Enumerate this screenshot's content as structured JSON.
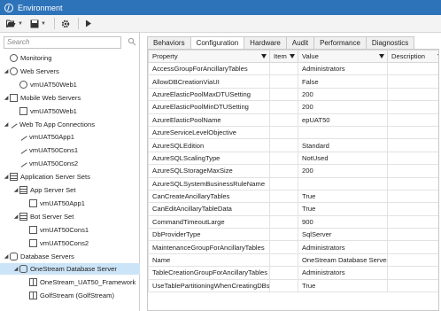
{
  "window": {
    "title": "Environment"
  },
  "toolbar": {
    "open_icon": "folder-open-icon",
    "save_icon": "save-icon",
    "settings_icon": "gear-icon",
    "run_icon": "play-icon"
  },
  "search": {
    "placeholder": "Search"
  },
  "tree": [
    {
      "label": "Monitoring",
      "icon": "monitor",
      "indent": 0,
      "twisty": ""
    },
    {
      "label": "Web Servers",
      "icon": "globe",
      "indent": 0,
      "twisty": "◢"
    },
    {
      "label": "vmUAT50Web1",
      "icon": "globe",
      "indent": 1,
      "twisty": ""
    },
    {
      "label": "Mobile Web Servers",
      "icon": "box",
      "indent": 0,
      "twisty": "◢"
    },
    {
      "label": "vmUAT50Web1",
      "icon": "box",
      "indent": 1,
      "twisty": ""
    },
    {
      "label": "Web To App Connections",
      "icon": "link",
      "indent": 0,
      "twisty": "◢"
    },
    {
      "label": "vmUAT50App1",
      "icon": "link",
      "indent": 1,
      "twisty": ""
    },
    {
      "label": "vmUAT50Cons1",
      "icon": "link",
      "indent": 1,
      "twisty": ""
    },
    {
      "label": "vmUAT50Cons2",
      "icon": "link",
      "indent": 1,
      "twisty": ""
    },
    {
      "label": "Application Server Sets",
      "icon": "server",
      "indent": 0,
      "twisty": "◢"
    },
    {
      "label": "App Server Set",
      "icon": "server",
      "indent": 1,
      "twisty": "◢"
    },
    {
      "label": "vmUAT50App1",
      "icon": "box",
      "indent": 2,
      "twisty": ""
    },
    {
      "label": "Bot Server Set",
      "icon": "server",
      "indent": 1,
      "twisty": "◢"
    },
    {
      "label": "vmUAT50Cons1",
      "icon": "box",
      "indent": 2,
      "twisty": ""
    },
    {
      "label": "vmUAT50Cons2",
      "icon": "box",
      "indent": 2,
      "twisty": ""
    },
    {
      "label": "Database Servers",
      "icon": "db",
      "indent": 0,
      "twisty": "◢"
    },
    {
      "label": "OneStream Database Server",
      "icon": "db",
      "indent": 1,
      "twisty": "◢",
      "selected": true
    },
    {
      "label": "OneStream_UAT50_Framework",
      "icon": "table",
      "indent": 2,
      "twisty": ""
    },
    {
      "label": "GolfStream (GolfStream)",
      "icon": "table",
      "indent": 2,
      "twisty": ""
    }
  ],
  "tabs": [
    "Behaviors",
    "Configuration",
    "Hardware",
    "Audit",
    "Performance",
    "Diagnostics"
  ],
  "grid": {
    "columns": [
      "Property",
      "Item",
      "Value",
      "Description"
    ],
    "rows": [
      [
        "AccessGroupForAncillaryTables",
        "",
        "Administrators",
        ""
      ],
      [
        "AllowDBCreationViaUI",
        "",
        "False",
        ""
      ],
      [
        "AzureElasticPoolMaxDTUSetting",
        "",
        "200",
        ""
      ],
      [
        "AzureElasticPoolMinDTUSetting",
        "",
        "200",
        ""
      ],
      [
        "AzureElasticPoolName",
        "",
        "epUAT50",
        ""
      ],
      [
        "AzureServiceLevelObjective",
        "",
        "",
        ""
      ],
      [
        "AzureSQLEdition",
        "",
        "Standard",
        ""
      ],
      [
        "AzureSQLScalingType",
        "",
        "NotUsed",
        ""
      ],
      [
        "AzureSQLStorageMaxSize",
        "",
        "200",
        ""
      ],
      [
        "AzureSQLSystemBusinessRuleName",
        "",
        "",
        ""
      ],
      [
        "CanCreateAncillaryTables",
        "",
        "True",
        ""
      ],
      [
        "CanEditAncillaryTableData",
        "",
        "True",
        ""
      ],
      [
        "CommandTimeoutLarge",
        "",
        "900",
        ""
      ],
      [
        "DbProviderType",
        "",
        "SqlServer",
        ""
      ],
      [
        "MaintenanceGroupForAncillaryTables",
        "",
        "Administrators",
        ""
      ],
      [
        "Name",
        "",
        "OneStream Database Server",
        ""
      ],
      [
        "TableCreationGroupForAncillaryTables",
        "",
        "Administrators",
        ""
      ],
      [
        "UseTablePartitioningWhenCreatingDBs",
        "",
        "True",
        ""
      ]
    ]
  }
}
